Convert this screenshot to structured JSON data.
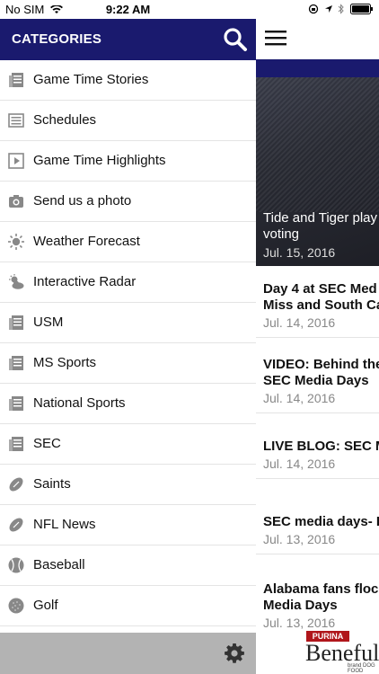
{
  "status_bar": {
    "carrier": "No SIM",
    "time": "9:22 AM"
  },
  "drawer": {
    "title": "CATEGORIES",
    "items": [
      {
        "label": "Game Time Stories",
        "icon": "news-icon"
      },
      {
        "label": "Schedules",
        "icon": "list-icon"
      },
      {
        "label": "Game Time Highlights",
        "icon": "video-icon"
      },
      {
        "label": "Send us a photo",
        "icon": "camera-icon"
      },
      {
        "label": "Weather Forecast",
        "icon": "sun-icon"
      },
      {
        "label": "Interactive Radar",
        "icon": "partly-cloudy-icon"
      },
      {
        "label": "USM",
        "icon": "news-icon"
      },
      {
        "label": "MS Sports",
        "icon": "news-icon"
      },
      {
        "label": "National Sports",
        "icon": "news-icon"
      },
      {
        "label": "SEC",
        "icon": "news-icon"
      },
      {
        "label": "Saints",
        "icon": "football-icon"
      },
      {
        "label": "NFL News",
        "icon": "football-icon"
      },
      {
        "label": "Baseball",
        "icon": "baseball-icon"
      },
      {
        "label": "Golf",
        "icon": "golf-ball-icon"
      }
    ]
  },
  "feed": {
    "hero": {
      "title": "Tide and Tiger play\nvoting",
      "date": "Jul. 15, 2016"
    },
    "stories": [
      {
        "title": "Day 4 at SEC Med\nMiss and South Ca",
        "date": "Jul. 14, 2016"
      },
      {
        "title": "VIDEO: Behind the\nSEC Media Days",
        "date": "Jul. 14, 2016"
      },
      {
        "title": "LIVE BLOG: SEC M",
        "date": "Jul. 14, 2016"
      },
      {
        "title": "SEC media days- I",
        "date": "Jul. 13, 2016"
      },
      {
        "title": "Alabama fans flock\nMedia Days",
        "date": "Jul. 13, 2016"
      }
    ]
  },
  "ad": {
    "brand": "PURINA",
    "name": "Beneful",
    "sub": "brand DOG FOOD"
  },
  "colors": {
    "header_blue": "#1a1a6e",
    "bottom_bar": "#b3b3b3"
  }
}
